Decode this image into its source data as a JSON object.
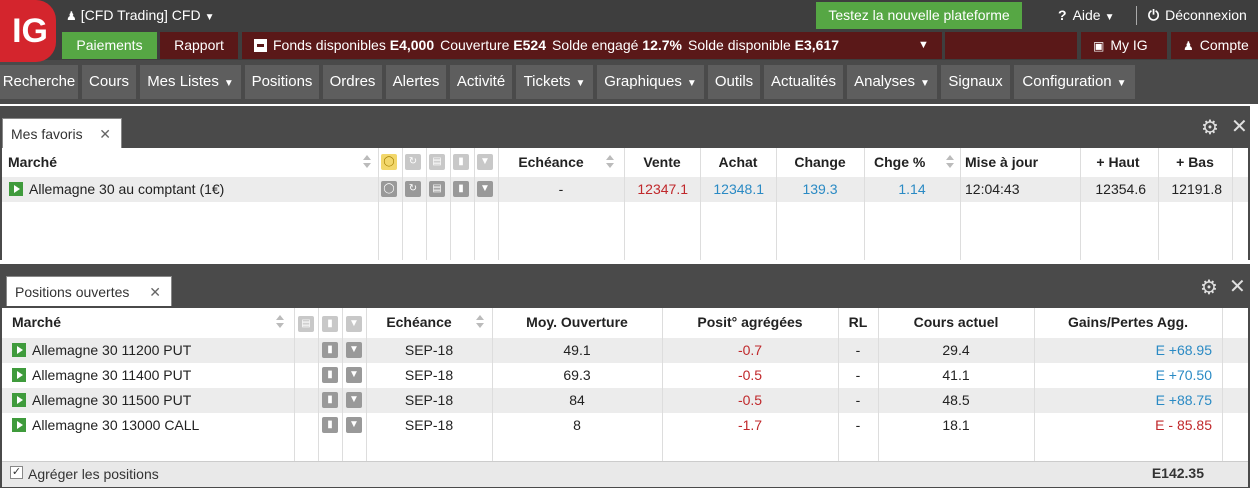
{
  "header": {
    "logo_text": "IG",
    "account_label": "[CFD Trading] CFD",
    "try_platform": "Testez la nouvelle plateforme",
    "help": "Aide",
    "logout": "Déconnexion"
  },
  "account_bar": {
    "payments": "Paiements",
    "report": "Rapport",
    "funds_label": "Fonds disponibles",
    "funds_value": "E4,000",
    "coverage_label": "Couverture",
    "coverage_value": "E524",
    "committed_label": "Solde engagé",
    "committed_value": "12.7%",
    "available_label": "Solde disponible",
    "available_value": "E3,617",
    "myig": "My IG",
    "account": "Compte"
  },
  "menu": [
    {
      "label": "Recherche",
      "dropdown": false
    },
    {
      "label": "Cours",
      "dropdown": false
    },
    {
      "label": "Mes Listes",
      "dropdown": true
    },
    {
      "label": "Positions",
      "dropdown": false
    },
    {
      "label": "Ordres",
      "dropdown": false
    },
    {
      "label": "Alertes",
      "dropdown": false
    },
    {
      "label": "Activité",
      "dropdown": false
    },
    {
      "label": "Tickets",
      "dropdown": true
    },
    {
      "label": "Graphiques",
      "dropdown": true
    },
    {
      "label": "Outils",
      "dropdown": false
    },
    {
      "label": "Actualités",
      "dropdown": false
    },
    {
      "label": "Analyses",
      "dropdown": true
    },
    {
      "label": "Signaux",
      "dropdown": false
    },
    {
      "label": "Configuration",
      "dropdown": true
    }
  ],
  "favorites": {
    "tab_label": "Mes favoris",
    "columns": {
      "market": "Marché",
      "expiry": "Echéance",
      "sell": "Vente",
      "buy": "Achat",
      "change": "Change",
      "change_pct": "Chge %",
      "updated": "Mise à jour",
      "high": "+ Haut",
      "low": "+ Bas"
    },
    "rows": [
      {
        "market": "Allemagne 30 au comptant (1€)",
        "expiry": "-",
        "sell": "12347.1",
        "buy": "12348.1",
        "change": "139.3",
        "change_pct": "1.14",
        "updated": "12:04:43",
        "high": "12354.6",
        "low": "12191.8"
      }
    ]
  },
  "positions": {
    "tab_label": "Positions ouvertes",
    "columns": {
      "market": "Marché",
      "expiry": "Echéance",
      "avg_open": "Moy. Ouverture",
      "aggregated": "Posit° agrégées",
      "rl": "RL",
      "current": "Cours actuel",
      "pnl": "Gains/Pertes Agg."
    },
    "rows": [
      {
        "market": "Allemagne 30 11200 PUT",
        "expiry": "SEP-18",
        "avg_open": "49.1",
        "aggregated": "-0.7",
        "rl": "-",
        "current": "29.4",
        "pnl": "E +68.95",
        "pnl_color": "#2a8ac4"
      },
      {
        "market": "Allemagne 30 11400 PUT",
        "expiry": "SEP-18",
        "avg_open": "69.3",
        "aggregated": "-0.5",
        "rl": "-",
        "current": "41.1",
        "pnl": "E +70.50",
        "pnl_color": "#2a8ac4"
      },
      {
        "market": "Allemagne 30 11500 PUT",
        "expiry": "SEP-18",
        "avg_open": "84",
        "aggregated": "-0.5",
        "rl": "-",
        "current": "48.5",
        "pnl": "E +88.75",
        "pnl_color": "#2a8ac4"
      },
      {
        "market": "Allemagne 30 13000 CALL",
        "expiry": "SEP-18",
        "avg_open": "8",
        "aggregated": "-1.7",
        "rl": "-",
        "current": "18.1",
        "pnl": "E - 85.85",
        "pnl_color": "#c0282b"
      }
    ],
    "aggregate_label": "Agréger les positions",
    "total": "E142.35"
  },
  "colors": {
    "brand_red": "#d4252d",
    "green": "#56a744",
    "dark_red": "#5a1818",
    "sell_red": "#c0282b",
    "buy_blue": "#2a8ac4"
  }
}
